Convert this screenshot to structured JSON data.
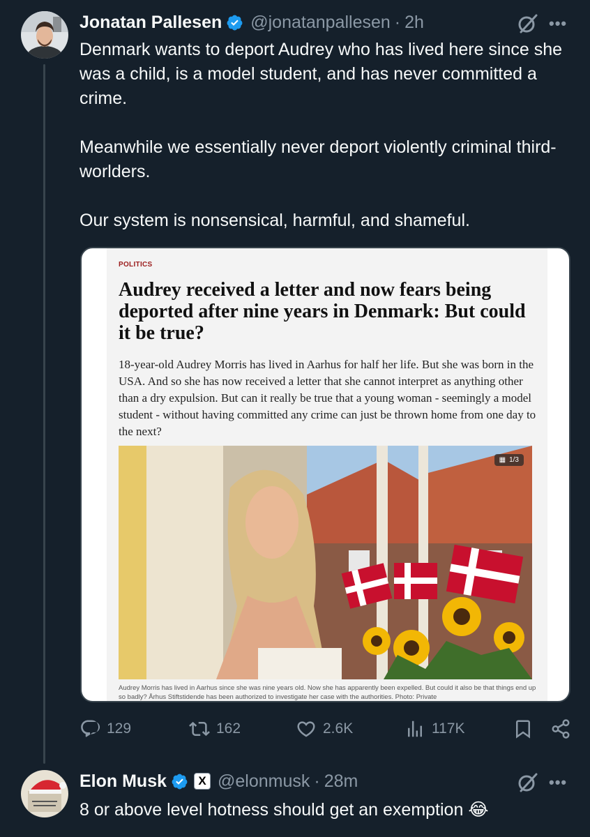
{
  "tweet1": {
    "author_name": "Jonatan Pallesen",
    "handle": "@jonatanpallesen",
    "separator": "·",
    "time": "2h",
    "paragraphs": [
      "Denmark wants to deport Audrey who has lived here since she was a child, is a model student, and has never committed a crime.",
      "Meanwhile we essentially never deport violently criminal third-worlders.",
      "Our system is nonsensical, harmful, and shameful."
    ],
    "more_label": "•••",
    "article": {
      "section": "POLITICS",
      "headline": "Audrey received a letter and now fears being deported after nine years in Denmark: But could it be true?",
      "dek": "18-year-old Audrey Morris has lived in Aarhus for half her life. But she was born in the USA. And so she has now received a letter that she cannot interpret as anything other than a dry expulsion. But can it really be true that a young woman - seemingly a model student - without having committed any crime can just be thrown home from one day to the next?",
      "photo_counter": "1/3",
      "caption": "Audrey Morris has lived in Aarhus since she was nine years old. Now she has apparently been expelled. But could it also be that things end up so badly? Århus Stiftstidende has been authorized to investigate her case with the authorities. Photo: Private"
    },
    "stats": {
      "replies": "129",
      "reposts": "162",
      "likes": "2.6K",
      "views": "117K"
    }
  },
  "tweet2": {
    "author_name": "Elon Musk",
    "affiliate_badge": "X",
    "handle": "@elonmusk",
    "separator": "·",
    "time": "28m",
    "text": "8 or above level hotness should get an exemption",
    "emoji": "😂",
    "more_label": "•••"
  },
  "colors": {
    "background": "#15202b",
    "text_primary": "#f7f9f9",
    "text_secondary": "#8b98a5",
    "verified_blue": "#1d9bf0",
    "border": "#38444d",
    "section_red": "#9b1c1c"
  },
  "icons": {
    "verified": "verified-badge-icon",
    "grok": "grok-icon",
    "reply": "reply-icon",
    "repost": "repost-icon",
    "like": "heart-icon",
    "views": "views-icon",
    "bookmark": "bookmark-icon",
    "share": "share-icon"
  }
}
